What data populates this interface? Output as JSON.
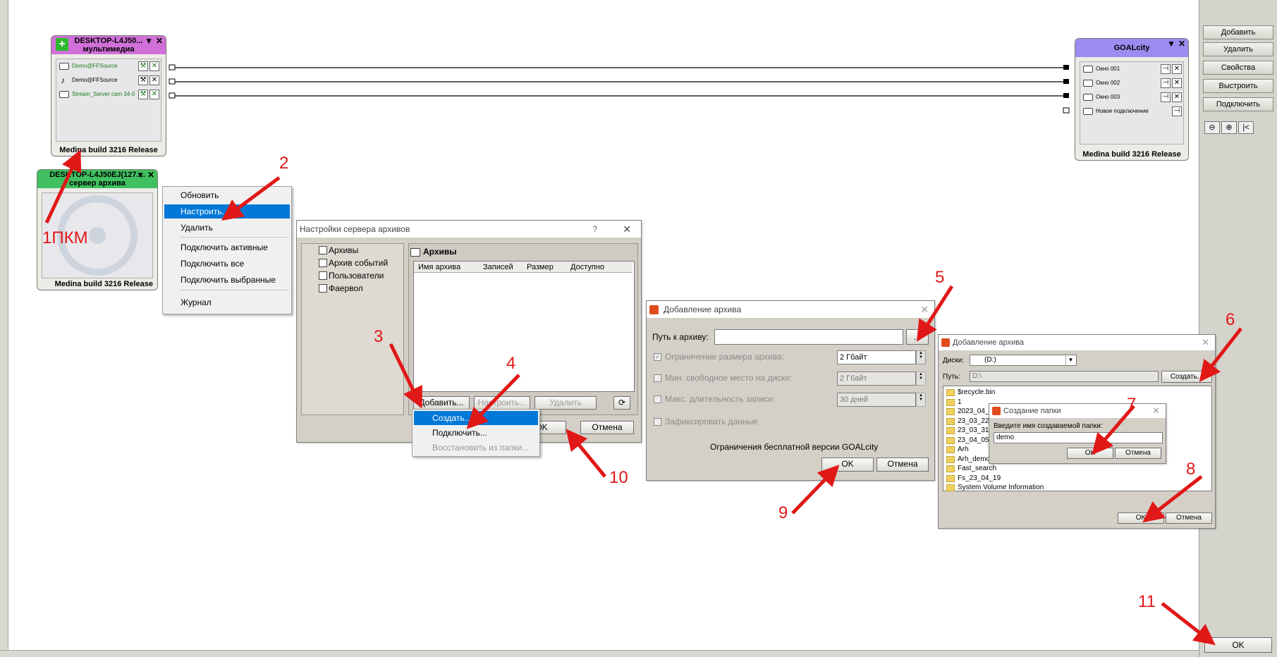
{
  "right_panel": {
    "buttons": [
      "Добавить",
      "Удалить",
      "Свойства",
      "Выстроить",
      "Подключить"
    ],
    "ok_label": "OK"
  },
  "node_multimedia": {
    "title": "DESKTOP-L4J50...",
    "subtitle": "мультимедиа",
    "rows": [
      "Demo@FFSource",
      "Demo@FFSource",
      "Stream_Server cam 34-0"
    ],
    "footer": "Medina build 3216 Release",
    "color": "#d070d8"
  },
  "node_archive": {
    "title": "DESKTOP-L4J50EJ(127....",
    "subtitle": "сервер архива",
    "footer": "Medina build 3216 Release",
    "color": "#40c060"
  },
  "node_goal": {
    "title": "GOALcity",
    "rows": [
      "Окно 001",
      "Окно 002",
      "Окно 003",
      "Новое подключение"
    ],
    "footer": "Medina build 3216 Release",
    "color": "#9a8cf0"
  },
  "context_menu": {
    "items": [
      "Обновить",
      "Настроить...",
      "Удалить",
      "Подключить активные",
      "Подключить все",
      "Подключить выбранные",
      "Журнал"
    ]
  },
  "settings_dialog": {
    "title": "Настройки сервера архивов",
    "help": "?",
    "close": "✕",
    "tree": [
      "Архивы",
      "Архив событий",
      "Пользователи",
      "Фаервол"
    ],
    "panel_title": "Архивы",
    "columns": [
      "Имя архива",
      "Записей",
      "Размер",
      "Доступно"
    ],
    "buttons": {
      "add": "Добавить...",
      "config": "Настроить...",
      "delete": "Удалить"
    },
    "ok": "OK",
    "cancel": "Отмена"
  },
  "add_menu": {
    "items": [
      "Создать...",
      "Подключить...",
      "Восстановить из папки..."
    ]
  },
  "add_archive_dialog": {
    "title": "Добавление архива",
    "path_label": "Путь к архиву:",
    "browse": "...",
    "limit_size_label": "Ограничение размера архива:",
    "limit_size_value": "2 Гбайт",
    "min_free_label": "Мин. свободное место на диске:",
    "min_free_value": "2 Гбайт",
    "max_dur_label": "Макс. длительность записи:",
    "max_dur_value": "30 дней",
    "fix_label": "Зафиксировать данные",
    "free_note": "Ограничения бесплатной версии GOALcity",
    "ok": "OK",
    "cancel": "Отмена"
  },
  "folder_dialog": {
    "title": "Добавление архива",
    "disks_label": "Диски:",
    "disk_value": "(D:)",
    "path_label": "Путь:",
    "path_value": "D:\\",
    "create": "Создать...",
    "folders": [
      "$recycle.bin",
      "1",
      "2023_04_2",
      "23_03_22",
      "23_03_31",
      "23_04_05",
      "Arh",
      "Arh_demo",
      "Fast_search",
      "Fs_23_04_19",
      "System Volume Information"
    ],
    "ok": "OK",
    "cancel": "Отмена"
  },
  "create_folder_dialog": {
    "title": "Создание папки",
    "prompt": "Введите имя создаваемой папки:",
    "value": "demo",
    "ok": "OK",
    "cancel": "Отмена"
  },
  "annotations": [
    "1ПКМ",
    "2",
    "3",
    "4",
    "5",
    "6",
    "7",
    "8",
    "9",
    "10",
    "11"
  ]
}
